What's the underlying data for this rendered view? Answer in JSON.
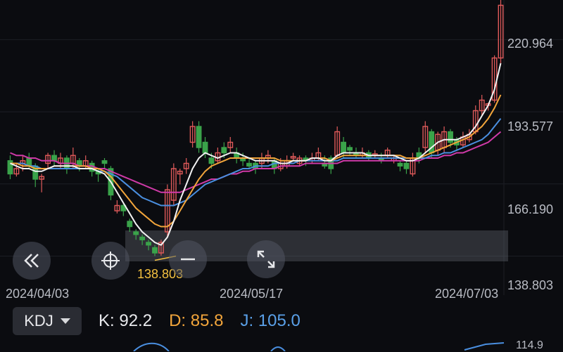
{
  "price_axis": {
    "labels": [
      "220.964",
      "193.577",
      "166.190",
      "138.803"
    ],
    "min": 124.0,
    "max": 236.0
  },
  "date_axis": [
    "2024/04/03",
    "2024/05/17",
    "2024/07/03"
  ],
  "low_marker": "138.803",
  "side_label": "114.9",
  "colors": {
    "background": "#0b0c10",
    "up": "#e05a5a",
    "down": "#3aa34a",
    "ma_white": "#f2f2f2",
    "ma_orange": "#f2a53b",
    "ma_blue": "#4a8fe0",
    "ma_magenta": "#d03aa8"
  },
  "controls": {
    "back_icon": "double-chevron-left-icon",
    "crosshair_icon": "crosshair-icon",
    "zoom_out_icon": "minus-icon",
    "fullscreen_icon": "expand-arrows-icon"
  },
  "indicator": {
    "selected": "KDJ",
    "k_label": "K:",
    "k_value": "92.2",
    "d_label": "D:",
    "d_value": "85.8",
    "j_label": "J:",
    "j_value": "105.0"
  },
  "chart_data": {
    "type": "candlestick",
    "candles": [
      [
        175,
        170,
        177,
        168
      ],
      [
        170,
        172,
        174,
        169
      ],
      [
        174,
        175,
        177,
        171
      ],
      [
        176,
        173,
        178,
        172
      ],
      [
        173,
        168,
        174,
        165
      ],
      [
        168,
        169,
        170,
        163
      ],
      [
        174,
        177,
        178,
        172
      ],
      [
        177,
        175,
        179,
        173
      ],
      [
        174,
        176,
        178,
        172
      ],
      [
        176,
        172,
        177,
        170
      ],
      [
        174,
        177,
        180,
        172
      ],
      [
        175,
        173,
        176,
        171
      ],
      [
        173,
        175,
        177,
        172
      ],
      [
        174,
        171,
        175,
        169
      ],
      [
        171,
        170,
        172,
        167
      ],
      [
        175,
        174,
        176,
        172
      ],
      [
        172,
        162,
        173,
        160
      ],
      [
        156,
        158,
        160,
        155
      ],
      [
        158,
        156,
        159,
        154
      ],
      [
        152,
        150,
        153,
        148
      ],
      [
        148,
        147,
        149,
        145
      ],
      [
        146,
        145,
        147,
        143
      ],
      [
        144,
        143,
        145,
        141
      ],
      [
        142,
        140,
        143,
        138.8
      ],
      [
        140,
        144,
        145,
        139
      ],
      [
        148,
        164,
        166,
        146
      ],
      [
        160,
        172,
        174,
        158
      ],
      [
        170,
        171,
        172,
        166
      ],
      [
        172,
        174,
        176,
        170
      ],
      [
        182,
        188,
        190,
        180
      ],
      [
        188,
        180,
        190,
        178
      ],
      [
        182,
        178,
        184,
        176
      ],
      [
        176,
        174,
        178,
        172
      ],
      [
        175,
        178,
        180,
        174
      ],
      [
        180,
        178,
        182,
        176
      ],
      [
        180,
        182,
        184,
        178
      ],
      [
        178,
        176,
        180,
        174
      ],
      [
        176,
        175,
        178,
        173
      ],
      [
        174,
        173,
        176,
        172
      ],
      [
        174,
        172,
        175,
        170
      ],
      [
        174,
        176,
        178,
        172
      ],
      [
        176,
        177,
        179,
        174
      ],
      [
        175,
        172,
        176,
        170
      ],
      [
        172,
        174,
        176,
        171
      ],
      [
        173,
        175,
        177,
        172
      ],
      [
        176,
        176.6,
        178,
        175
      ],
      [
        174,
        176,
        177,
        173
      ],
      [
        176,
        175,
        177,
        173
      ],
      [
        175,
        176,
        178,
        174
      ],
      [
        176,
        178,
        180,
        175
      ],
      [
        174,
        173,
        177,
        172
      ],
      [
        176,
        172,
        177,
        170
      ],
      [
        177,
        186,
        188,
        176
      ],
      [
        182,
        178,
        184,
        176
      ],
      [
        180,
        179,
        181,
        177
      ],
      [
        178,
        177,
        180,
        176
      ],
      [
        177,
        178,
        180,
        176
      ],
      [
        178,
        176,
        179,
        175
      ],
      [
        177,
        177.6,
        179,
        176
      ],
      [
        176,
        175,
        178,
        174
      ],
      [
        177,
        179,
        180,
        176
      ],
      [
        175,
        176,
        177,
        174
      ],
      [
        174,
        173,
        175,
        171
      ],
      [
        174,
        172,
        175,
        170
      ],
      [
        170,
        176,
        178,
        169
      ],
      [
        178,
        176,
        180,
        174
      ],
      [
        180,
        188,
        190,
        178
      ],
      [
        186,
        178,
        187,
        176
      ],
      [
        179,
        185,
        186,
        177
      ],
      [
        180,
        186,
        188,
        178
      ],
      [
        186,
        182,
        187,
        180
      ],
      [
        183,
        181,
        184,
        179
      ],
      [
        181,
        184,
        186,
        180
      ],
      [
        183,
        185,
        187,
        182
      ],
      [
        186,
        194,
        196,
        185
      ],
      [
        194,
        198,
        200,
        192
      ],
      [
        196,
        196.6,
        197,
        194
      ],
      [
        198,
        214,
        215,
        197
      ],
      [
        214,
        234,
        236,
        212
      ]
    ],
    "ma_white": [
      174,
      173,
      172,
      172,
      171,
      171,
      172,
      173,
      173,
      173,
      173,
      172,
      172,
      172,
      171,
      170,
      167,
      163,
      159,
      155,
      151,
      148,
      146,
      144,
      143,
      146,
      152,
      160,
      166,
      172,
      176,
      178,
      177,
      176,
      177,
      178,
      178,
      177,
      176,
      175,
      175,
      175,
      175,
      174,
      174,
      175,
      175,
      175,
      176,
      176,
      175,
      175,
      177,
      178,
      178,
      178,
      178,
      177,
      177,
      177,
      177,
      177,
      176,
      175,
      175,
      176,
      178,
      180,
      182,
      183,
      183,
      183,
      184,
      185,
      188,
      192,
      196,
      202,
      212
    ],
    "ma_orange": [
      174,
      174,
      173,
      173,
      172,
      172,
      172,
      173,
      173,
      173,
      173,
      173,
      173,
      172,
      172,
      171,
      169,
      166,
      163,
      160,
      157,
      155,
      153,
      151,
      150,
      150,
      152,
      156,
      160,
      164,
      168,
      171,
      173,
      174,
      175,
      176,
      176,
      176,
      176,
      176,
      176,
      176,
      176,
      175,
      175,
      175,
      175,
      175,
      176,
      176,
      176,
      175,
      176,
      177,
      177,
      177,
      177,
      177,
      177,
      177,
      177,
      177,
      177,
      176,
      176,
      176,
      177,
      178,
      179,
      180,
      181,
      182,
      183,
      184,
      186,
      188,
      191,
      195,
      200
    ],
    "ma_blue": [
      174,
      174,
      174,
      173,
      173,
      172,
      172,
      172,
      172,
      172,
      172,
      172,
      172,
      172,
      171,
      171,
      170,
      169,
      167,
      165,
      163,
      161,
      160,
      159,
      158,
      158,
      158,
      159,
      160,
      162,
      164,
      166,
      167,
      168,
      169,
      170,
      171,
      172,
      172,
      173,
      173,
      173,
      174,
      174,
      174,
      174,
      175,
      175,
      175,
      175,
      175,
      175,
      175,
      176,
      176,
      176,
      176,
      176,
      176,
      176,
      176,
      176,
      176,
      176,
      176,
      176,
      176,
      177,
      177,
      178,
      178,
      179,
      180,
      181,
      182,
      183,
      185,
      188,
      191
    ],
    "ma_magenta": [
      178,
      177,
      177,
      176,
      176,
      175,
      175,
      175,
      174,
      174,
      174,
      173,
      173,
      173,
      172,
      172,
      171,
      170,
      169,
      168,
      167,
      166,
      165,
      164,
      163,
      163,
      163,
      163,
      164,
      165,
      166,
      167,
      168,
      168,
      169,
      170,
      170,
      171,
      171,
      172,
      172,
      172,
      172,
      173,
      173,
      173,
      173,
      174,
      174,
      174,
      174,
      174,
      174,
      175,
      175,
      175,
      175,
      175,
      175,
      175,
      175,
      175,
      175,
      175,
      175,
      175,
      176,
      176,
      176,
      177,
      177,
      178,
      178,
      179,
      180,
      181,
      182,
      184,
      186
    ]
  }
}
